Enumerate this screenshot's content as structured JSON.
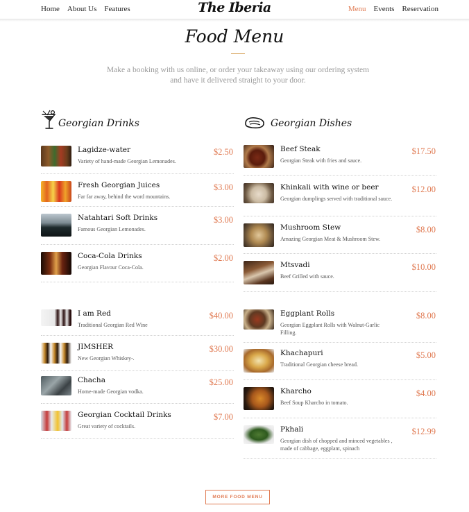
{
  "nav": {
    "left": [
      "Home",
      "About Us",
      "Features"
    ],
    "brand": "The Iberia",
    "right": [
      "Menu",
      "Events",
      "Reservation"
    ],
    "active": "Menu"
  },
  "header": {
    "title": "Food Menu",
    "intro": "Make a booking with us online, or order your takeaway using our ordering system and have it delivered straight to your door."
  },
  "drinks": {
    "heading": "Georgian Drinks",
    "icon": "cocktail-icon",
    "items": [
      {
        "name": "Lagidze-water",
        "desc": "Variety of hand-made Georgian Lemonades.",
        "price": "$2.50"
      },
      {
        "name": "Fresh Georgian Juices",
        "desc": "Far far away, behind the word mountains.",
        "price": "$3.00"
      },
      {
        "name": "Natahtari Soft Drinks",
        "desc": "Famous Georgian Lemonades.",
        "price": "$3.00"
      },
      {
        "name": "Coca-Cola Drinks",
        "desc": "Georgian Flavour Coca-Cola.",
        "price": "$2.00"
      },
      {
        "name": "I am Red",
        "desc": "Traditional Georgian Red Wine",
        "price": "$40.00"
      },
      {
        "name": "JIMSHER",
        "desc": "New Georgian Whiskey-.",
        "price": "$30.00"
      },
      {
        "name": "Chacha",
        "desc": "Home-made Georgian vodka.",
        "price": "$25.00"
      },
      {
        "name": "Georgian Cocktail Drinks",
        "desc": "Great variety of cocktails.",
        "price": "$7.00"
      }
    ]
  },
  "dishes": {
    "heading": "Georgian Dishes",
    "icon": "steak-icon",
    "items": [
      {
        "name": "Beef Steak",
        "desc": "Georgian Steak with fries and sauce.",
        "price": "$17.50"
      },
      {
        "name": "Khinkali with wine or beer",
        "desc": "Georgian dumplings served with traditional sauce.",
        "price": "$12.00"
      },
      {
        "name": "Mushroom Stew",
        "desc": "Amazing Georgian Meat & Mushroom Stew.",
        "price": "$8.00"
      },
      {
        "name": "Mtsvadi",
        "desc": "Beef Grilled with sauce.",
        "price": "$10.00"
      },
      {
        "name": "Eggplant Rolls",
        "desc": "Georgian Eggplant Rolls with Walnut-Garlic Filling.",
        "price": "$8.00"
      },
      {
        "name": "Khachapuri",
        "desc": "Traditional Georgian cheese bread.",
        "price": "$5.00"
      },
      {
        "name": "Kharcho",
        "desc": "Beef Soup Kharcho in tomato.",
        "price": "$4.00"
      },
      {
        "name": "Pkhali",
        "desc": "Georgian dish of chopped and minced vegetables , made of cabbage, eggplant, spinach",
        "price": "$12.99"
      }
    ]
  },
  "more_button": "MORE FOOD MENU",
  "colors": {
    "accent": "#e07a52",
    "rule": "#d39a4a",
    "muted": "#9a9a9a"
  }
}
